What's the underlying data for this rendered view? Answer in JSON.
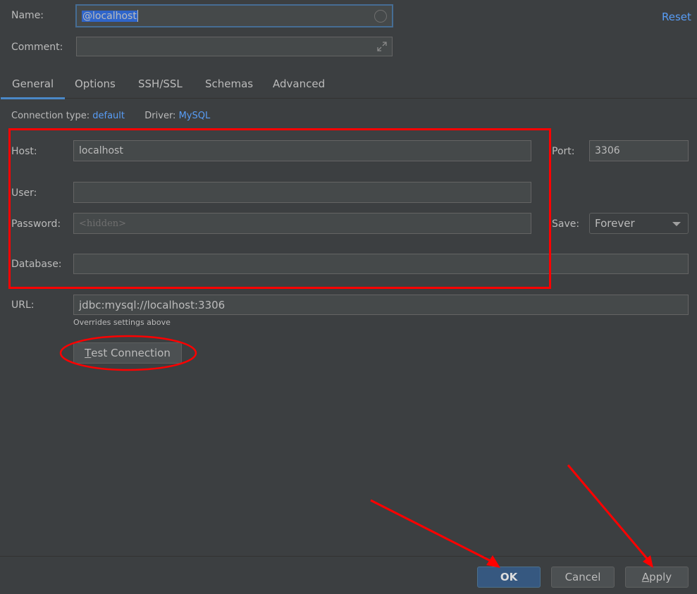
{
  "header": {
    "name_label": "Name:",
    "name_value": "@localhost",
    "comment_label": "Comment:",
    "comment_value": "",
    "reset_label": "Reset"
  },
  "tabs": [
    {
      "label": "General",
      "active": true
    },
    {
      "label": "Options",
      "active": false
    },
    {
      "label": "SSH/SSL",
      "active": false
    },
    {
      "label": "Schemas",
      "active": false
    },
    {
      "label": "Advanced",
      "active": false
    }
  ],
  "connection": {
    "type_label": "Connection type:",
    "type_value": "default",
    "driver_label": "Driver:",
    "driver_value": "MySQL"
  },
  "form": {
    "host_label": "Host:",
    "host_value": "localhost",
    "port_label": "Port:",
    "port_value": "3306",
    "user_label": "User:",
    "user_value": "",
    "password_label": "Password:",
    "password_placeholder": "<hidden>",
    "save_label": "Save:",
    "save_value": "Forever",
    "database_label": "Database:",
    "database_value": "",
    "url_label": "URL:",
    "url_value": "jdbc:mysql://localhost:3306",
    "url_hint": "Overrides settings above"
  },
  "buttons": {
    "test_connection_mnemonic": "T",
    "test_connection_rest": "est Connection",
    "ok": "OK",
    "cancel": "Cancel",
    "apply_mnemonic": "A",
    "apply_rest": "pply"
  },
  "colors": {
    "background": "#3c3f41",
    "accent": "#4a88c7",
    "link": "#589df6",
    "annotation": "#ff0000"
  }
}
